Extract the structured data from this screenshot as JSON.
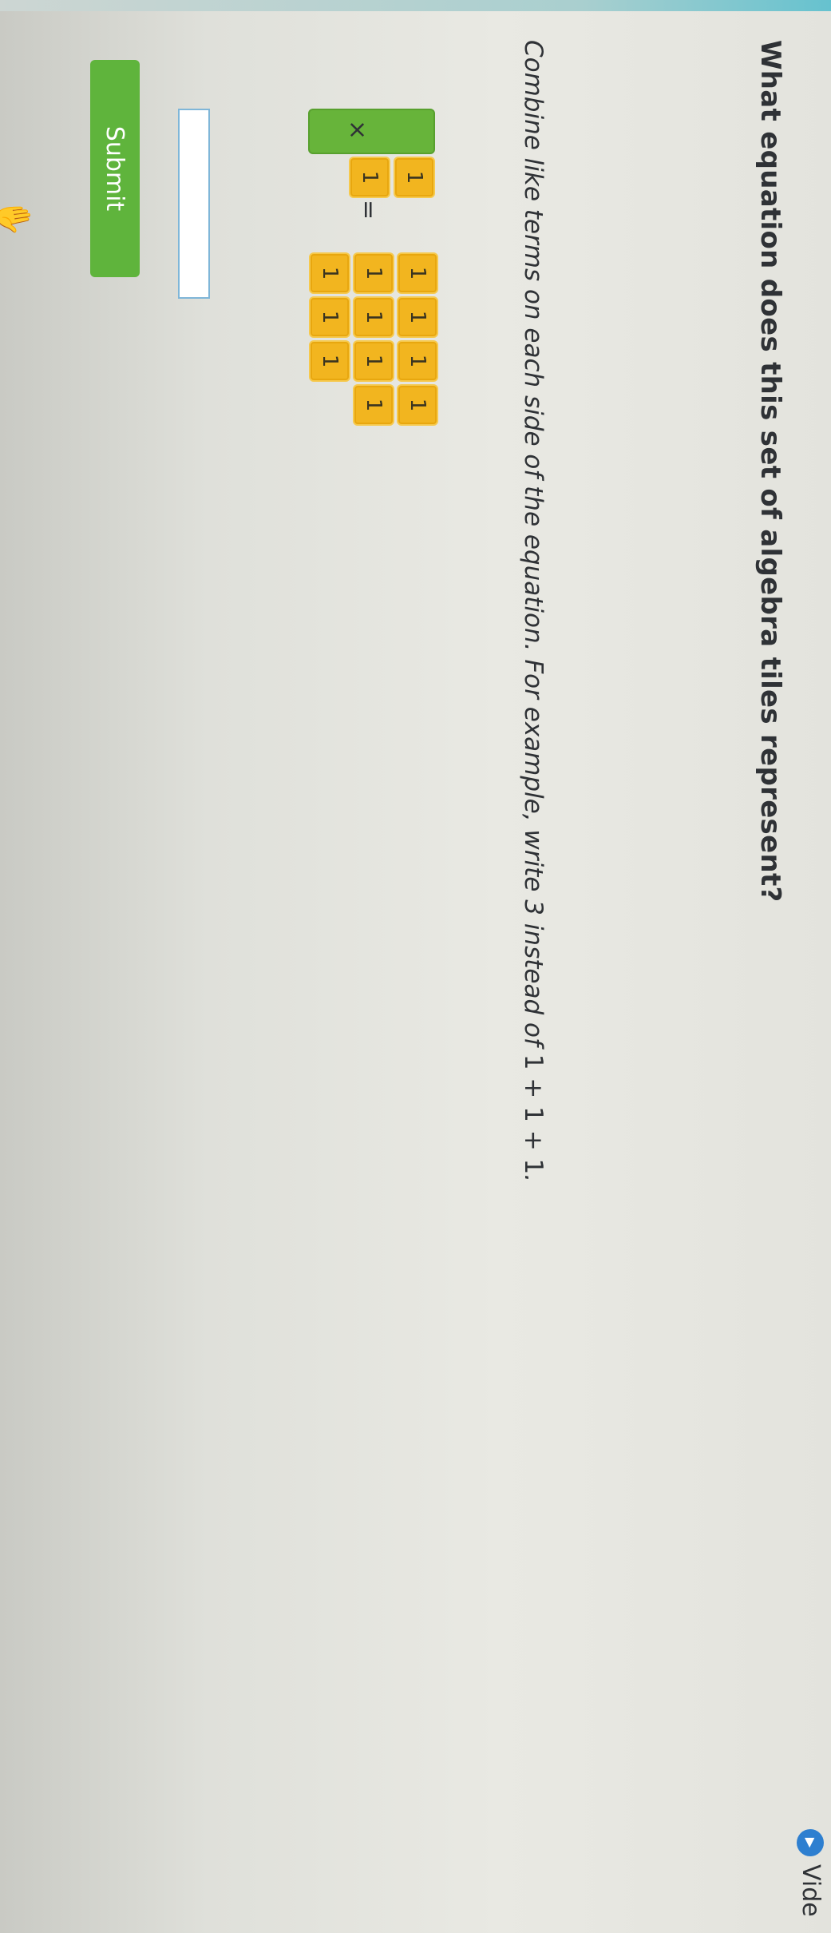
{
  "header": {
    "question": "What equation does this set of algebra tiles represent?",
    "video_label": "Vide",
    "video_icon": "play-icon"
  },
  "tiles": {
    "left_top": {
      "x_label": "",
      "unit_label": "1"
    },
    "multiply_symbol": "×",
    "left_bottom": {
      "unit_label": "1"
    },
    "equals_symbol": "=",
    "right_rows": [
      [
        "1",
        "1",
        "1",
        "1"
      ],
      [
        "1",
        "1",
        "1",
        "1"
      ],
      [
        "1",
        "1",
        "1"
      ]
    ],
    "colors": {
      "x_tile": "#67b43a",
      "unit_tile": "#f2b51f"
    }
  },
  "instruction": {
    "text": "Combine like terms on each side of the equation. For example, write ",
    "example_value": "3",
    "middle": " instead of ",
    "example_expression": "1 + 1 + 1",
    "end": "."
  },
  "answer": {
    "value": ""
  },
  "submit": {
    "label": "Submit",
    "color": "#5fb43c"
  },
  "cursor": {
    "icon": "pointer-hand-icon"
  }
}
